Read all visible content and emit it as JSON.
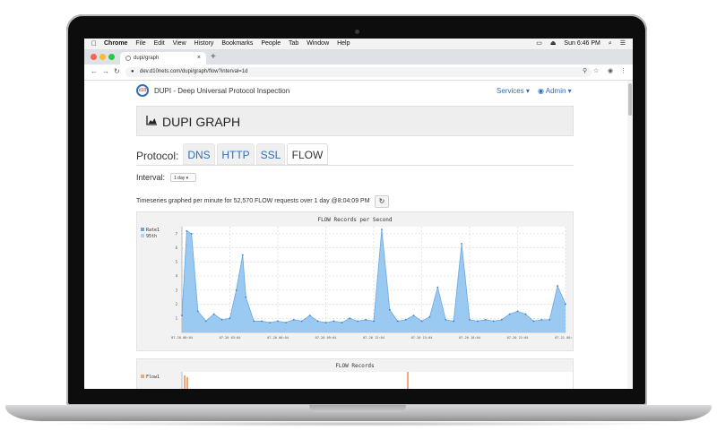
{
  "menubar": {
    "apple_icon": "apple-icon",
    "app_name": "Chrome",
    "items": [
      "File",
      "Edit",
      "View",
      "History",
      "Bookmarks",
      "People",
      "Tab",
      "Window",
      "Help"
    ],
    "clock": "Sun 6:46 PM"
  },
  "browser": {
    "tab_title": "dupi/graph",
    "tab_close": "×",
    "new_tab": "+",
    "url": "dev.d10nets.com/dupi/graph/flow?interval=1d"
  },
  "page": {
    "brand_logo": "d10",
    "brand": "DUPI - Deep Universal Protocol Inspection",
    "nav_services": "Services ▾",
    "nav_admin": "Admin ▾",
    "title": "DUPI GRAPH",
    "protocol_label": "Protocol:",
    "tabs": [
      "DNS",
      "HTTP",
      "SSL",
      "FLOW"
    ],
    "active_tab": "FLOW",
    "interval_label": "Interval:",
    "interval_value": "1 day",
    "timeseries_text": "Timeseries graphed per minute for 52,570 FLOW requests over 1 day @8:04:09 PM"
  },
  "colors": {
    "accent": "#2f6fb7",
    "rate_fill": "#8fc3ef",
    "rate_line": "#6aa9e0",
    "p95": "#a9d3f7",
    "flow": "#f0a878"
  },
  "chart_data": [
    {
      "type": "area",
      "title": "FLOW Records per Second",
      "legend": [
        "Rate1",
        "95th"
      ],
      "legend_position": "top-left",
      "y_ticks": [
        1,
        2,
        3,
        4,
        5,
        6,
        7
      ],
      "ylim": [
        0,
        7.5
      ],
      "grid": true,
      "x_tick_labels": [
        "07-20 00:04",
        "07-20 03:04",
        "07-20 06:04",
        "07-20 09:04",
        "07-20 12:04",
        "07-20 15:04",
        "07-20 18:04",
        "07-20 21:04",
        "07-21 00:04"
      ],
      "x": [
        0,
        0.3,
        0.6,
        1,
        1.5,
        2,
        2.5,
        3,
        3.4,
        3.8,
        4,
        4.5,
        5,
        5.5,
        6,
        6.5,
        7,
        7.5,
        8,
        8.5,
        9,
        9.5,
        10,
        10.5,
        11,
        11.5,
        12,
        12.5,
        13,
        13.5,
        14,
        14.5,
        15,
        15.5,
        16,
        16.5,
        17,
        17.5,
        18,
        18.5,
        19,
        19.5,
        20,
        20.5,
        21,
        21.5,
        22,
        22.5,
        23,
        23.5,
        24
      ],
      "series": [
        {
          "name": "Rate1",
          "values": [
            1.2,
            7.2,
            7.0,
            1.5,
            0.8,
            1.3,
            0.9,
            1.0,
            3.0,
            5.5,
            2.5,
            0.8,
            0.8,
            0.7,
            0.8,
            0.7,
            0.9,
            0.8,
            1.2,
            0.8,
            0.7,
            0.8,
            0.7,
            1.0,
            0.8,
            0.9,
            0.8,
            7.3,
            1.6,
            0.8,
            0.9,
            1.2,
            0.8,
            1.1,
            3.2,
            0.9,
            0.8,
            6.3,
            0.9,
            0.8,
            0.9,
            0.8,
            0.9,
            1.3,
            1.5,
            1.3,
            0.8,
            0.9,
            0.9,
            3.3,
            2.0
          ]
        }
      ]
    },
    {
      "type": "bar",
      "title": "FLOW Records",
      "legend": [
        "Flow1"
      ],
      "legend_position": "top-left",
      "grid": true
    }
  ]
}
